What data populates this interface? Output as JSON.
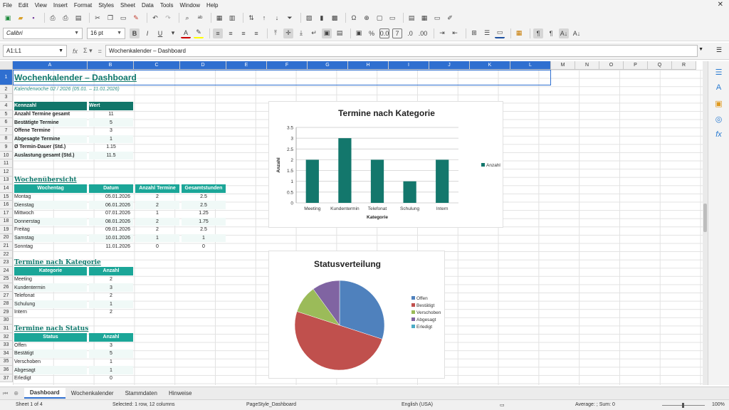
{
  "menu": [
    "File",
    "Edit",
    "View",
    "Insert",
    "Format",
    "Styles",
    "Sheet",
    "Data",
    "Tools",
    "Window",
    "Help"
  ],
  "toolbar": {
    "font_name": "Calibri",
    "font_size": "16 pt"
  },
  "formula_bar": {
    "name_box": "A1:L1",
    "content": "Wochenkalender – Dashboard"
  },
  "columns": [
    "A",
    "B",
    "C",
    "D",
    "E",
    "F",
    "G",
    "H",
    "I",
    "J",
    "K",
    "L",
    "M",
    "N",
    "O",
    "P",
    "Q",
    "R"
  ],
  "rows": [
    "1",
    "2",
    "3",
    "4",
    "5",
    "6",
    "7",
    "8",
    "9",
    "10",
    "11",
    "12",
    "13",
    "14",
    "15",
    "16",
    "17",
    "18",
    "19",
    "20",
    "21",
    "22",
    "23",
    "24",
    "25",
    "26",
    "27",
    "28",
    "29",
    "30",
    "31",
    "32",
    "33",
    "34",
    "35",
    "36",
    "37"
  ],
  "sheet": {
    "title": "Wochenkalender – Dashboard",
    "subtitle": "Kalenderwoche 02 / 2026 (05.01. – 11.01.2026)",
    "kpi": {
      "header": [
        "Kennzahl",
        "Wert"
      ],
      "rows": [
        [
          "Anzahl Termine gesamt",
          "11"
        ],
        [
          "Bestätigte Termine",
          "5"
        ],
        [
          "Offene Termine",
          "3"
        ],
        [
          "Abgesagte Termine",
          "1"
        ],
        [
          "Ø Termin-Dauer (Std.)",
          "1.15"
        ],
        [
          "Auslastung gesamt (Std.)",
          "11.5"
        ]
      ]
    },
    "week": {
      "title": "Wochenübersicht",
      "header": [
        "Wochentag",
        "Datum",
        "Anzahl Termine",
        "Gesamtstunden"
      ],
      "rows": [
        [
          "Montag",
          "05.01.2026",
          "2",
          "2.5"
        ],
        [
          "Dienstag",
          "06.01.2026",
          "2",
          "2.5"
        ],
        [
          "Mittwoch",
          "07.01.2026",
          "1",
          "1.25"
        ],
        [
          "Donnerstag",
          "08.01.2026",
          "2",
          "1.75"
        ],
        [
          "Freitag",
          "09.01.2026",
          "2",
          "2.5"
        ],
        [
          "Samstag",
          "10.01.2026",
          "1",
          "1"
        ],
        [
          "Sonntag",
          "11.01.2026",
          "0",
          "0"
        ]
      ]
    },
    "category": {
      "title": "Termine nach Kategorie",
      "header": [
        "Kategorie",
        "Anzahl"
      ],
      "rows": [
        [
          "Meeting",
          "2"
        ],
        [
          "Kundentermin",
          "3"
        ],
        [
          "Telefonat",
          "2"
        ],
        [
          "Schulung",
          "1"
        ],
        [
          "Intern",
          "2"
        ]
      ]
    },
    "status": {
      "title": "Termine nach Status",
      "header": [
        "Status",
        "Anzahl"
      ],
      "rows": [
        [
          "Offen",
          "3"
        ],
        [
          "Bestätigt",
          "5"
        ],
        [
          "Verschoben",
          "1"
        ],
        [
          "Abgesagt",
          "1"
        ],
        [
          "Erledigt",
          "0"
        ]
      ]
    }
  },
  "chart_data": [
    {
      "type": "bar",
      "title": "Termine nach Kategorie",
      "categories": [
        "Meeting",
        "Kundentermin",
        "Telefonat",
        "Schulung",
        "Intern"
      ],
      "series": [
        {
          "name": "Anzahl",
          "values": [
            2,
            3,
            2,
            1,
            2
          ]
        }
      ],
      "xlabel": "Kategorie",
      "ylabel": "Anzahl",
      "ylim": [
        0,
        3.5
      ],
      "yticks": [
        "0",
        "0.5",
        "1",
        "1.5",
        "2",
        "2.5",
        "3",
        "3.5"
      ],
      "grid": true,
      "legend": "right",
      "color": "#13776c"
    },
    {
      "type": "pie",
      "title": "Statusverteilung",
      "categories": [
        "Offen",
        "Bestätigt",
        "Verschoben",
        "Abgesagt",
        "Erledigt"
      ],
      "values": [
        3,
        5,
        1,
        1,
        0
      ],
      "colors": [
        "#4f81bd",
        "#c0504d",
        "#9bbb59",
        "#8064a2",
        "#4bacc6"
      ],
      "legend": "right"
    }
  ],
  "tabs": [
    "Dashboard",
    "Wochenkalender",
    "Stammdaten",
    "Hinweise"
  ],
  "status_bar": {
    "sheet": "Sheet 1 of 4",
    "selection": "Selected: 1 row, 12 columns",
    "page_style": "PageStyle_Dashboard",
    "language": "English (USA)",
    "summary": "Average: ; Sum: 0",
    "zoom": "100%"
  }
}
